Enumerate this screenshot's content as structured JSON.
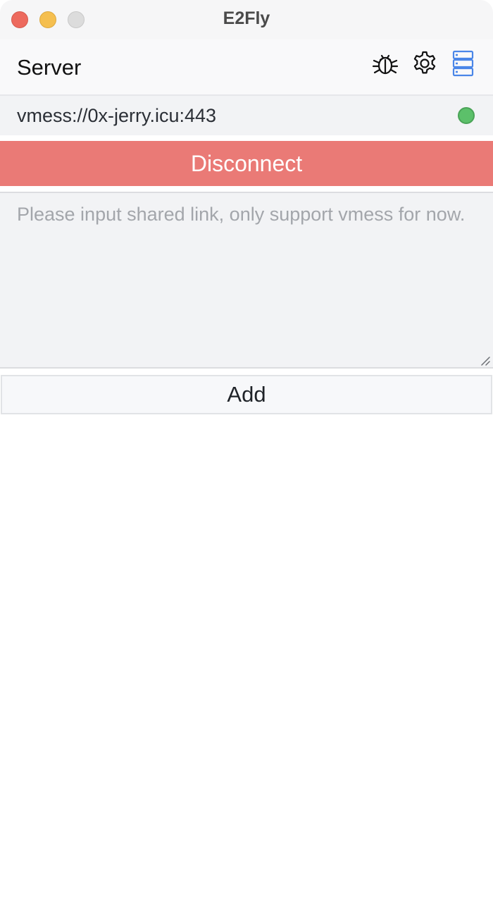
{
  "window": {
    "title": "E2Fly"
  },
  "header": {
    "title": "Server",
    "icons": [
      "bug-icon",
      "gear-icon",
      "server-list-icon"
    ]
  },
  "server": {
    "url": "vmess://0x-jerry.icu:443",
    "status": "connected",
    "status_color": "#5cc06a"
  },
  "actions": {
    "disconnect_label": "Disconnect",
    "disconnect_color": "#ea7a76",
    "add_label": "Add"
  },
  "link_input": {
    "value": "",
    "placeholder": "Please input shared link, only support vmess for now."
  },
  "colors": {
    "accent_blue": "#4a86e8",
    "close": "#ed6a5e",
    "minimize": "#f5bf4f",
    "maximize_disabled": "#dcdcdc"
  }
}
